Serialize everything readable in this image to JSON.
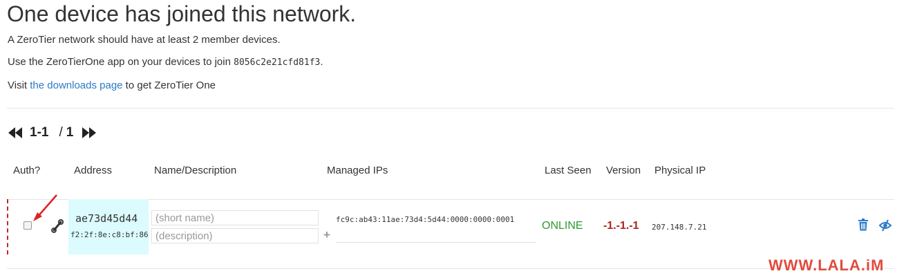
{
  "header": {
    "title": "One device has joined this network.",
    "line1": "A ZeroTier network should have at least 2 member devices.",
    "line2_prefix": "Use the ZeroTierOne app on your devices to join ",
    "network_id": "8056c2e21cfd81f3",
    "line2_suffix": ".",
    "line3_prefix": "Visit ",
    "downloads_link": "the downloads page",
    "line3_suffix": " to get ZeroTier One"
  },
  "pager": {
    "range": "1-1",
    "slash": "/",
    "total": "1"
  },
  "table": {
    "columns": {
      "auth": "Auth?",
      "address": "Address",
      "name": "Name/Description",
      "managed_ips": "Managed IPs",
      "last_seen": "Last Seen",
      "version": "Version",
      "physical_ip": "Physical IP"
    },
    "rows": [
      {
        "authorized": false,
        "address": "ae73d45d44",
        "mac": "f2:2f:8e:c8:bf:86",
        "name_placeholder": "(short name)",
        "description_placeholder": "(description)",
        "managed_ip": "fc9c:ab43:11ae:73d4:5d44:0000:0000:0001",
        "last_seen": "ONLINE",
        "version": "-1.-1.-1",
        "physical_ip": "207.148.7.21"
      }
    ]
  },
  "icons": {
    "first_page": "first-page-icon",
    "last_page": "last-page-icon",
    "wrench": "wrench-icon",
    "plus": "+",
    "trash": "trash-icon",
    "hide": "hide-icon"
  },
  "colors": {
    "link": "#2a7ac7",
    "online": "#2e9a2e",
    "version": "#a9261c",
    "address_bg": "#dbfbfe",
    "watermark": "#e24b3e"
  },
  "watermark": "WWW.LALA.iM"
}
